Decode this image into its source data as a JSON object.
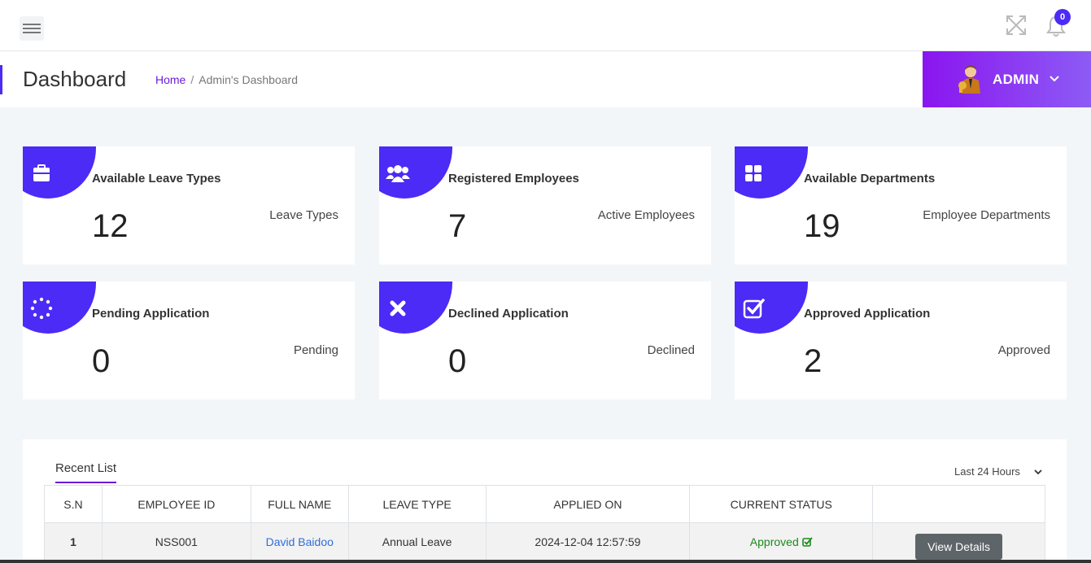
{
  "topbar": {
    "notification_count": "0"
  },
  "header": {
    "title": "Dashboard",
    "breadcrumb_home": "Home",
    "breadcrumb_current": "Admin's Dashboard",
    "breadcrumb_separator": "/",
    "user_label": "ADMIN"
  },
  "cards": [
    {
      "title": "Available Leave Types",
      "value": "12",
      "subtitle": "Leave Types",
      "icon": "briefcase-icon"
    },
    {
      "title": "Registered Employees",
      "value": "7",
      "subtitle": "Active Employees",
      "icon": "users-icon"
    },
    {
      "title": "Available Departments",
      "value": "19",
      "subtitle": "Employee Departments",
      "icon": "grid-icon"
    },
    {
      "title": "Pending Application",
      "value": "0",
      "subtitle": "Pending",
      "icon": "spinner-icon"
    },
    {
      "title": "Declined Application",
      "value": "0",
      "subtitle": "Declined",
      "icon": "x-icon"
    },
    {
      "title": "Approved Application",
      "value": "2",
      "subtitle": "Approved",
      "icon": "check-square-icon"
    }
  ],
  "recent": {
    "tab_label": "Recent List",
    "range_label": "Last 24 Hours",
    "columns": [
      "S.N",
      "EMPLOYEE ID",
      "FULL NAME",
      "LEAVE TYPE",
      "APPLIED ON",
      "CURRENT STATUS",
      ""
    ],
    "rows": [
      {
        "sn": "1",
        "employee_id": "NSS001",
        "full_name": "David Baidoo",
        "leave_type": "Annual Leave",
        "applied_on": "2024-12-04 12:57:59",
        "status": "Approved",
        "action": "View Details"
      }
    ]
  },
  "colors": {
    "accent": "#4b2bf5",
    "admin_gradient_start": "#8a15ef",
    "admin_gradient_end": "#8d5bf5",
    "status_approved": "#1a8a1a",
    "link": "#2f6fd8"
  }
}
